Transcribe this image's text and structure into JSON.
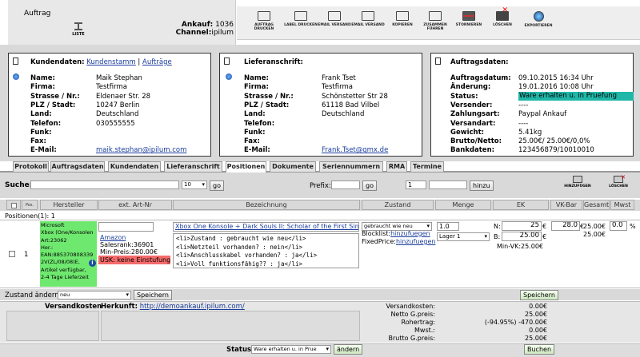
{
  "header": {
    "section": "Auftrag",
    "list_label": "LISTE",
    "ankauf_label": "Ankauf:",
    "ankauf_value": "1036",
    "channel_label": "Channel:",
    "channel_value": "ipilum"
  },
  "toolbar": {
    "items": [
      {
        "label": "AUFTRAG DRUCKEN",
        "icon": "printer-icon"
      },
      {
        "label": "LABEL DRUCKEN",
        "icon": "printer-icon"
      },
      {
        "label": "EMAIL VERSAND",
        "icon": "email-icon"
      },
      {
        "label": "EMAIL VERSAND",
        "icon": "email-forward-icon"
      },
      {
        "label": "KOPIEREN",
        "icon": "copy-icon"
      },
      {
        "label": "ZUSAMMEN FÜHREN",
        "icon": "merge-icon"
      },
      {
        "label": "STORNIEREN",
        "icon": "cancel-icon"
      },
      {
        "label": "LÖSCHEN",
        "icon": "delete-icon"
      },
      {
        "label": "EXPORTIEREN",
        "icon": "globe-icon"
      }
    ]
  },
  "kunde": {
    "title": "Kundendaten:",
    "link1": "Kundenstamm",
    "sep": " | ",
    "link2": "Aufträge",
    "rows": [
      [
        "Name:",
        "Maik Stephan"
      ],
      [
        "Firma:",
        "Testfirma"
      ],
      [
        "Strasse / Nr.:",
        "Eldenaer Str. 28"
      ],
      [
        "PLZ / Stadt:",
        "10247 Berlin"
      ],
      [
        "Land:",
        "Deutschland"
      ],
      [
        "Telefon:",
        "030555555"
      ],
      [
        "Funk:",
        ""
      ],
      [
        "Fax:",
        ""
      ],
      [
        "E-Mail:",
        "maik.stephan@ipilum.com"
      ]
    ]
  },
  "liefer": {
    "title": "Lieferanschrift:",
    "rows": [
      [
        "Name:",
        "Frank Tset"
      ],
      [
        "Firma:",
        "Testfirma"
      ],
      [
        "Strasse / Nr.:",
        "Schönstetter Str 28"
      ],
      [
        "PLZ / Stadt:",
        "61118 Bad Vilbel"
      ],
      [
        "Land:",
        "Deutschland"
      ],
      [
        "Telefon:",
        ""
      ],
      [
        "Funk:",
        ""
      ],
      [
        "Fax:",
        ""
      ],
      [
        "E-Mail:",
        "Frank.Tset@gmx.de"
      ]
    ]
  },
  "auftrag": {
    "title": "Auftragsdaten:",
    "rows": [
      [
        "Auftragsdatum:",
        "09.10.2015 16:34 Uhr"
      ],
      [
        "Änderung:",
        "19.01.2016 10:08 Uhr"
      ],
      [
        "Status:",
        "Ware erhalten u. in Pruefung"
      ],
      [
        "Versender:",
        "----"
      ],
      [
        "Zahlungsart:",
        "Paypal Ankauf"
      ],
      [
        "Versandart:",
        "----"
      ],
      [
        "Gewicht:",
        "5.41kg"
      ],
      [
        "Brutto/Netto:",
        "25.00€/ 25.00€/0,0%"
      ],
      [
        "Bankdaten:",
        "123456879/10010010"
      ]
    ],
    "status_color": "#1fb7a8"
  },
  "tabs": [
    "Protokoll",
    "Auftragsdaten",
    "Kundendaten",
    "Lieferanschrift",
    "Positionen",
    "Dokumente",
    "Seriennummern",
    "RMA",
    "Termine"
  ],
  "search": {
    "label": "Suche:",
    "count": "10",
    "go": "go",
    "prefix_label": "Prefix:",
    "prefix_go": "go",
    "qty": "1",
    "hinzu": "hinzu",
    "add_label": "HINZUFÜGEN",
    "del_label": "LÖSCHEN"
  },
  "columns": [
    "Pos.",
    "Hersteller",
    "ext. Art-Nr",
    "Bezeichnung",
    "Zustand",
    "Menge",
    "EK",
    "VK-Bar",
    "Gesamt",
    "Mwst"
  ],
  "positions_label": "Positionen(1): 1",
  "item": {
    "pos": "1",
    "hersteller_lines": [
      "Microsoft",
      "Xbox (One/Konsolen",
      "Art:23062",
      "Her.:",
      "EAN:885370808339"
    ],
    "hersteller_extra": [
      "2V(ZL/08/08)E,",
      "Artikel verfügbar,",
      "2-4 Tage Lieferzeit"
    ],
    "ext_link": "Amazon",
    "salesrank": "Salesrank:36901",
    "min_preis": "Min-Preis:280.00€",
    "usk": "USK: keine Einstufung",
    "bez_title": "Xbox One Konsole + Dark Souls II: Scholar of the First Sin",
    "bez_lines": [
      "<li>Zustand : gebraucht wie neu</li>",
      "<li>Netzteil vorhanden? : nein</li>",
      "<li>Anschlusskabel vorhanden? : ja</li>",
      "<li>Voll funktionsfähig?? : ja</li>"
    ],
    "zustand": "gebraucht wie neu",
    "blocklist": "Blocklist:",
    "blocklist_link": "hinzufuegen",
    "fixedprice": "FixedPrice:",
    "fixedprice_link": "hinzufuegen",
    "menge": "1.0",
    "lager": "Lager 1",
    "ek_n_label": "N:",
    "ek_n": "25",
    "ek_b_label": "B:",
    "ek_b": "25.00",
    "min_vk": "Min-VK:25.00€",
    "vk_bar": "28.0",
    "gesamt1": "25.00€",
    "gesamt2": "25.00€",
    "mwst": "0.0",
    "mwst_unit": "%"
  },
  "change": {
    "label": "Zustand ändern",
    "value": "neu",
    "save": "Speichern",
    "save2": "Speichern"
  },
  "shipping": {
    "label": "Versandkosten",
    "herkunft_label": "Herkunft:",
    "herkunft_url": "http://demoankauf.ipilum.com/"
  },
  "totals": [
    [
      "Versandkosten:",
      "0.00€"
    ],
    [
      "Netto G.preis:",
      "25.00€"
    ],
    [
      "Rohertrag:",
      "(-94.95%) -470.00€"
    ],
    [
      "Mwst.:",
      "0.00€"
    ],
    [
      "Brutto G.preis:",
      "25.00€"
    ]
  ],
  "footer": {
    "status_label": "Status:",
    "status_value": "Ware erhalten u. in Prue",
    "aendern": "ändern",
    "buchen": "Buchen"
  },
  "euro": "€"
}
